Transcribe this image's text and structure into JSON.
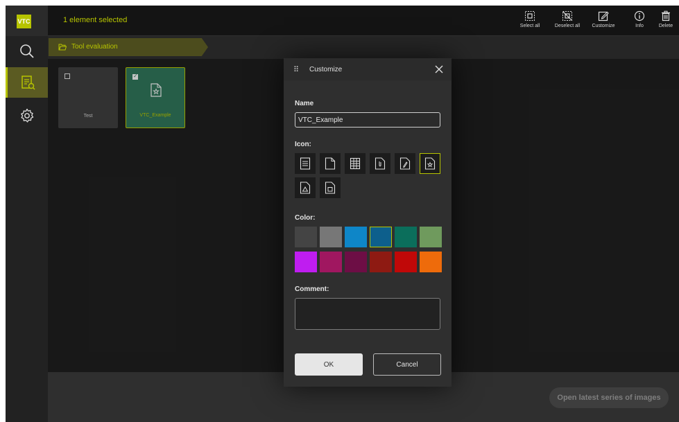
{
  "app": {
    "logo_text": "VTC"
  },
  "rail": {
    "items": [
      {
        "icon": "search-icon",
        "active": false
      },
      {
        "icon": "document-check-icon",
        "active": true
      },
      {
        "icon": "gear-icon",
        "active": false
      }
    ]
  },
  "header": {
    "selection_status": "1 element selected",
    "toolbar": {
      "select_all": "Select all",
      "deselect_all": "Deselect all",
      "customize": "Customize",
      "info": "Info",
      "delete": "Delete"
    }
  },
  "breadcrumb": {
    "label": "Tool evaluation",
    "icon": "folder-open-icon"
  },
  "tiles": [
    {
      "name": "Test",
      "checked": false
    },
    {
      "name": "VTC_Example",
      "checked": true,
      "icon": "document-star-icon"
    }
  ],
  "bottom": {
    "open_latest_label": "Open latest series of images"
  },
  "dialog": {
    "title": "Customize",
    "name_label": "Name",
    "name_value": "VTC_Example",
    "icon_label": "Icon:",
    "icons": [
      "document-lines-icon",
      "document-blank-icon",
      "table-icon",
      "document-clip-icon",
      "document-edit-icon",
      "document-star-icon",
      "document-triangle-icon",
      "document-square-icon"
    ],
    "selected_icon": "document-star-icon",
    "color_label": "Color:",
    "colors": [
      "#444444",
      "#777777",
      "#0e86c8",
      "#0d5f8c",
      "#0b6e5b",
      "#6f9a5d",
      "#bf1df0",
      "#a01760",
      "#6d0e45",
      "#8e1a12",
      "#c00808",
      "#ee6b0b"
    ],
    "selected_color": "#0d5f8c",
    "comment_label": "Comment:",
    "comment_value": "",
    "ok_label": "OK",
    "cancel_label": "Cancel"
  },
  "colors": {
    "accent": "#b7c400",
    "panel": "#2f2f2f",
    "background": "#1b1b1b"
  }
}
